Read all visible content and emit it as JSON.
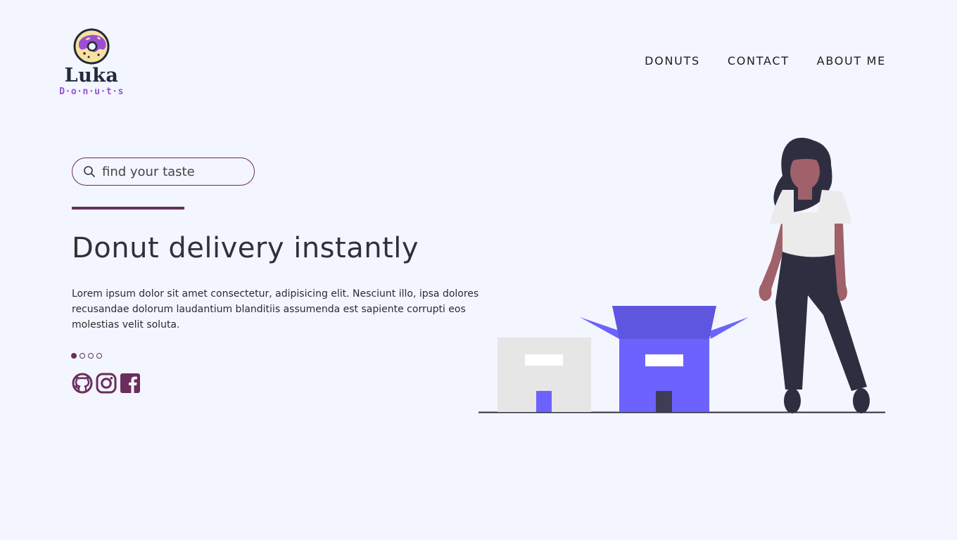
{
  "brand": {
    "name": "Luka",
    "sub": "D·o·n·u·t·s"
  },
  "nav": {
    "items": [
      {
        "label": "DONUTS"
      },
      {
        "label": "CONTACT"
      },
      {
        "label": "ABOUT ME"
      }
    ]
  },
  "search": {
    "placeholder": "find your taste",
    "icon": "search-icon"
  },
  "hero": {
    "title": "Donut delivery instantly",
    "body": "Lorem ipsum dolor sit amet consectetur, adipisicing elit. Nesciunt illo, ipsa dolores recusandae dolorum laudantium blanditiis assumenda est sapiente corrupti eos molestias velit soluta."
  },
  "carousel": {
    "count": 4,
    "active_index": 0
  },
  "social": {
    "icons": [
      "github-icon",
      "instagram-icon",
      "facebook-icon"
    ]
  },
  "colors": {
    "background": "#f3f6ff",
    "accent": "#6b2d5e",
    "brand_purple": "#9b4fd0",
    "box_blue": "#6c63ff"
  }
}
